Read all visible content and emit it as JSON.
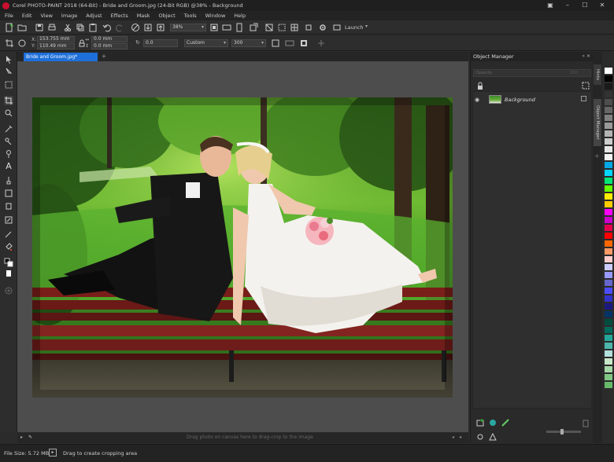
{
  "app": {
    "window_title": "Corel PHOTO-PAINT 2018 (64-Bit) - Bride and Groom.jpg (24-Bit RGB) @38% - Background"
  },
  "menu": [
    "File",
    "Edit",
    "View",
    "Image",
    "Adjust",
    "Effects",
    "Mask",
    "Object",
    "Tools",
    "Window",
    "Help"
  ],
  "toolbar": {
    "zoom_value": "38%",
    "launch_label": "Launch"
  },
  "property_bar": {
    "x_value": "153.755 mm",
    "y_value": "110.49 mm",
    "width_value": "0.0 mm",
    "height_value": "0.0 mm",
    "angle_value": "0.0",
    "preset_value": "Custom",
    "resolution_value": "300"
  },
  "document": {
    "tab_label": "Bride and Groom.jpg*",
    "canvas_hint": "Drag photo on canvas here to drag-crop to the image"
  },
  "object_manager": {
    "title": "Object Manager",
    "filter_placeholder": "Opacity",
    "opacity_value": "100",
    "layers": [
      {
        "name": "Background"
      }
    ]
  },
  "docker_tabs": [
    "Hints",
    "Object Manager"
  ],
  "status": {
    "file_size": "File Size: 5.72 MB",
    "hint": "Drag to create cropping area"
  },
  "palette_colors": [
    "#ffffff",
    "#000000",
    "#1a1a1a",
    "#333333",
    "#4d4d4d",
    "#666666",
    "#808080",
    "#999999",
    "#b3b3b3",
    "#cccccc",
    "#e6e6e6",
    "#f2f2f2",
    "#00a8e8",
    "#00d4ff",
    "#00e676",
    "#66ff00",
    "#ffeb00",
    "#ffcc00",
    "#ff00ff",
    "#cc00cc",
    "#e6004c",
    "#ff0000",
    "#ff6600",
    "#ff9966",
    "#ffcccc",
    "#ccccff",
    "#9999ff",
    "#6666cc",
    "#4d4dff",
    "#3333cc",
    "#1a1a80",
    "#003366",
    "#004d40",
    "#00695c",
    "#26a69a",
    "#4db6ac",
    "#b2dfdb",
    "#c8e6c9",
    "#a5d6a7",
    "#81c784",
    "#66bb6a"
  ]
}
